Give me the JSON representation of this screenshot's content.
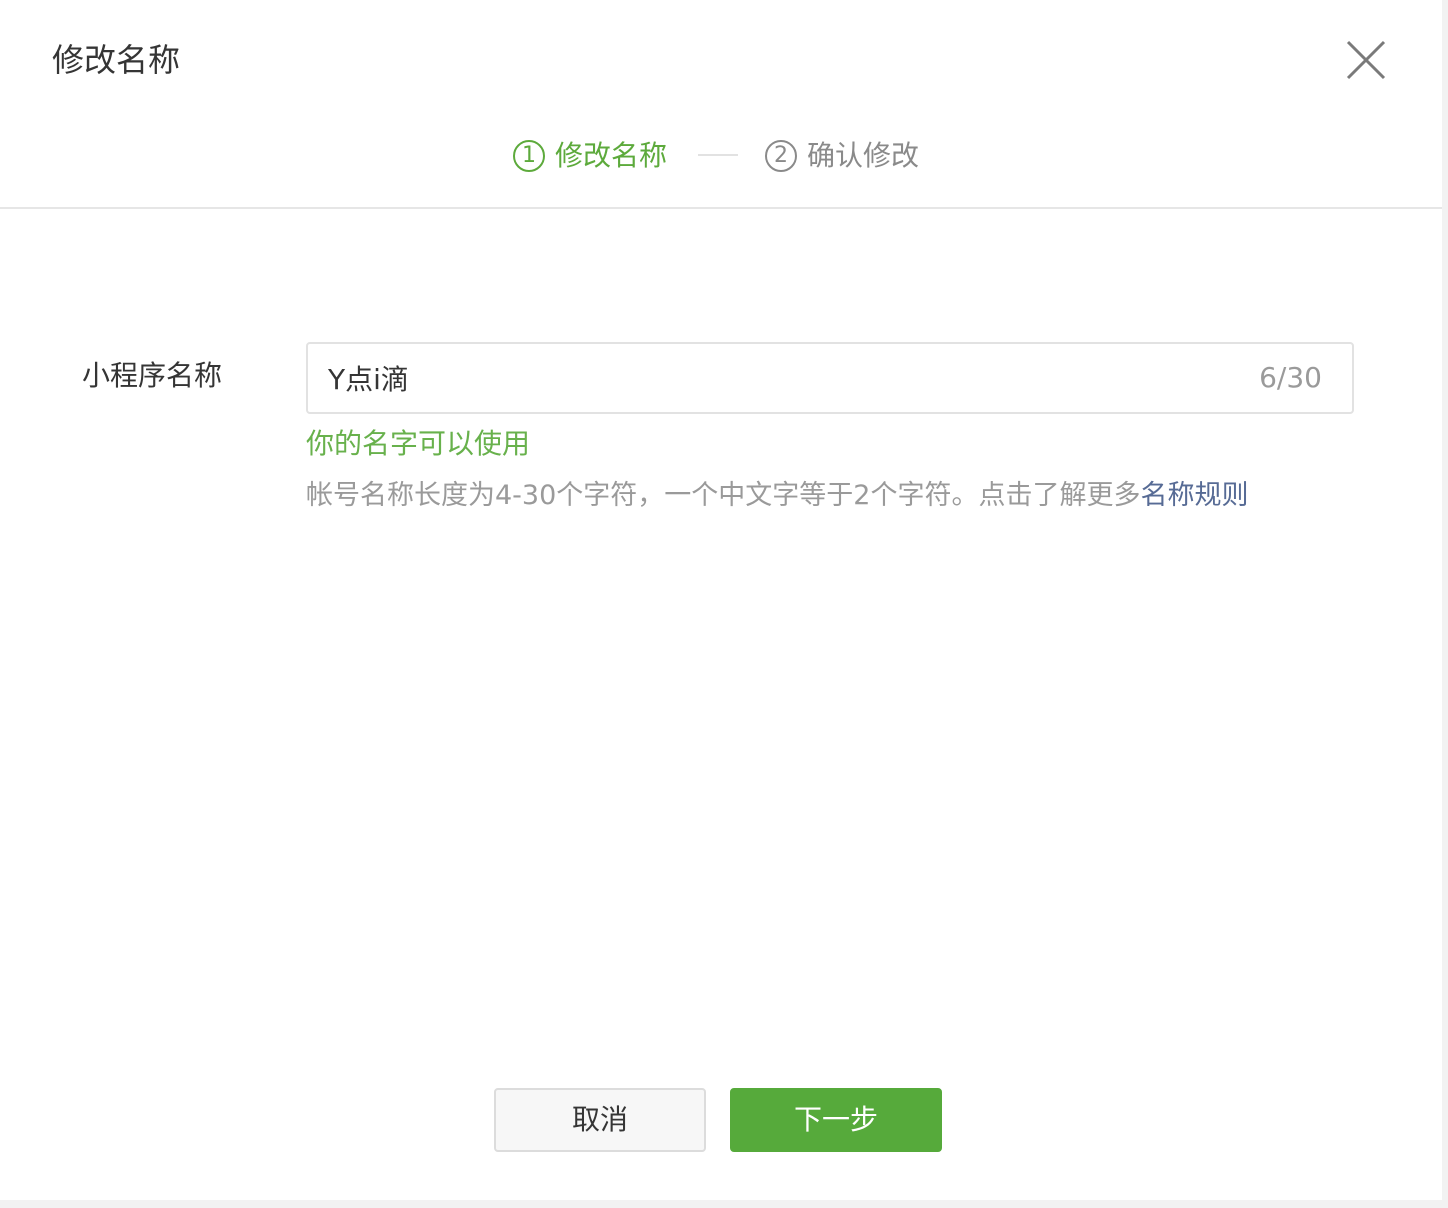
{
  "dialog": {
    "title": "修改名称",
    "close_icon": "close-icon"
  },
  "steps": [
    {
      "number": "1",
      "label": "修改名称",
      "state": "active",
      "color": "#5daa3c"
    },
    {
      "number": "2",
      "label": "确认修改",
      "state": "inactive",
      "color": "#8a8a8a"
    }
  ],
  "form": {
    "field_label": "小程序名称",
    "name_value": "Y点i滴",
    "char_count": "6/30",
    "valid_message": "你的名字可以使用",
    "hint_text": "帐号名称长度为4-30个字符，一个中文字等于2个字符。点击了解更多",
    "rule_link": "名称规则"
  },
  "buttons": {
    "cancel": "取消",
    "next": "下一步"
  },
  "colors": {
    "accent": "#56aa3b",
    "success_text": "#68b14c",
    "link": "#576b95"
  }
}
